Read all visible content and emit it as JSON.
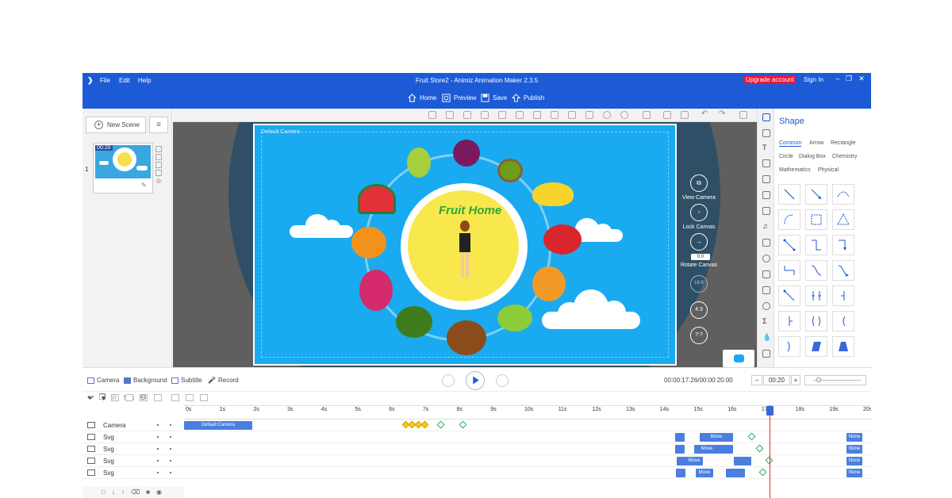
{
  "window": {
    "title": "Fruit Store2 - Animiz Animation Maker 2.3.5",
    "menu": [
      "File",
      "Edit",
      "Help"
    ],
    "upgrade_label": "Upgrade account",
    "signin_label": "Sign In",
    "toolbar": {
      "home": "Home",
      "preview": "Preview",
      "save": "Save",
      "publish": "Publish"
    }
  },
  "left_panel": {
    "new_scene_label": "New Scene",
    "scene_number": "1",
    "scene_time": "00:20"
  },
  "canvas": {
    "default_camera_label": "Default Camera",
    "title_text": "Fruit Home",
    "controls": {
      "view_camera": "View Camera",
      "lock_canvas": "Lock Canvas",
      "rotate_value": "0.0",
      "rotate_canvas": "Rotate Canvas",
      "ratio_169": "16:9",
      "ratio_43": "4:3",
      "ratio_custom": "?:?"
    }
  },
  "shape_panel": {
    "title": "Shape",
    "tabs": [
      "Common",
      "Arrow",
      "Rectangle",
      "Circle",
      "Dialog Box",
      "Chemistry",
      "Mathematics",
      "Physical"
    ],
    "active_tab": "Common"
  },
  "timeline": {
    "tabs": [
      "Camera",
      "Background",
      "Subtitle",
      "Record"
    ],
    "time_display": "00:00:17.26/00:00:20.00",
    "duration_input": "00:20",
    "ruler_ticks": [
      "0s",
      "1s",
      "2s",
      "3s",
      "4s",
      "5s",
      "6s",
      "7s",
      "8s",
      "9s",
      "10s",
      "11s",
      "12s",
      "13s",
      "14s",
      "15s",
      "16s",
      "17s",
      "18s",
      "19s",
      "20s"
    ],
    "tracks": [
      {
        "name": "Camera",
        "bar_label": "Default Camera"
      },
      {
        "name": "Svg",
        "bar_label": "Move",
        "end_label": "None"
      },
      {
        "name": "Svg",
        "bar_label": "Move",
        "end_label": "None"
      },
      {
        "name": "Svg",
        "bar_label": "Move",
        "end_label": "None"
      },
      {
        "name": "Svg",
        "bar_label": "Move",
        "end_label": "None"
      }
    ]
  },
  "colors": {
    "brand_blue": "#1d5bd6",
    "upgrade_red": "#e8173b",
    "stage_blue": "#1aaaf0",
    "playhead_red": "#ee2233",
    "keyframe_green": "#2ab25a"
  }
}
